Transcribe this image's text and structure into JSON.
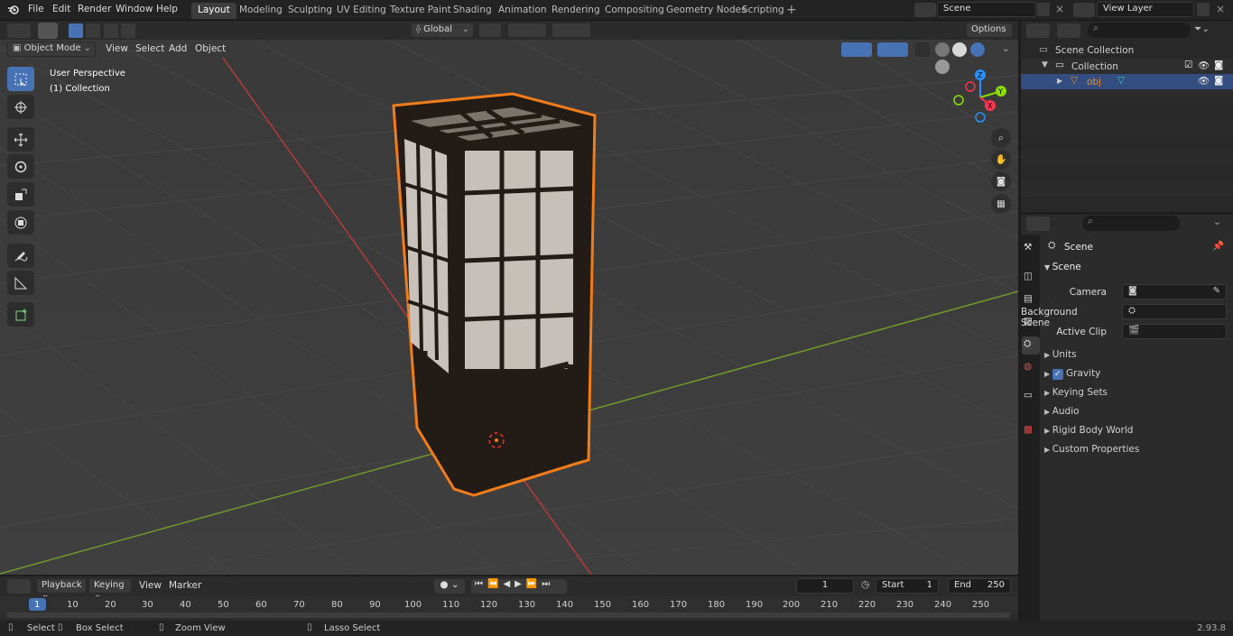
{
  "top_menu": [
    "File",
    "Edit",
    "Render",
    "Window",
    "Help"
  ],
  "workspaces": [
    "Layout",
    "Modeling",
    "Sculpting",
    "UV Editing",
    "Texture Paint",
    "Shading",
    "Animation",
    "Rendering",
    "Compositing",
    "Geometry Nodes",
    "Scripting"
  ],
  "scene_field": "Scene",
  "view_layer_field": "View Layer",
  "transform_orientation": "Global",
  "options_label": "Options",
  "mode_select": "Object Mode",
  "viewport_menu": [
    "View",
    "Select",
    "Add",
    "Object"
  ],
  "viewport_overlay": {
    "line1": "User Perspective",
    "line2": "(1) Collection"
  },
  "gizmo_axes": {
    "x": "X",
    "y": "Y",
    "z": "Z"
  },
  "outliner": {
    "scene_collection": "Scene Collection",
    "collection": "Collection",
    "object": "obj"
  },
  "properties": {
    "breadcrumb": "Scene",
    "panel_title": "Scene",
    "fields": [
      {
        "label": "Camera"
      },
      {
        "label": "Background Scene"
      },
      {
        "label": "Active Clip"
      }
    ],
    "sections": [
      "Units",
      "Gravity",
      "Keying Sets",
      "Audio",
      "Rigid Body World",
      "Custom Properties"
    ]
  },
  "timeline": {
    "menus": [
      "Playback",
      "Keying",
      "View",
      "Marker"
    ],
    "current_frame": "1",
    "start_label": "Start",
    "start_value": "1",
    "end_label": "End",
    "end_value": "250",
    "frame_markers": [
      "1",
      "10",
      "20",
      "30",
      "40",
      "50",
      "60",
      "70",
      "80",
      "90",
      "100",
      "110",
      "120",
      "130",
      "140",
      "150",
      "160",
      "170",
      "180",
      "190",
      "200",
      "210",
      "220",
      "230",
      "240",
      "250"
    ]
  },
  "statusbar": {
    "select": "Select",
    "box_select": "Box Select",
    "zoom_view": "Zoom View",
    "lasso_select": "Lasso Select",
    "version": "2.93.8"
  },
  "colors": {
    "accent": "#4772b3",
    "selection_outline": "#f07c1a",
    "x_axis": "#ff3352",
    "y_axis": "#8bdc00",
    "z_axis": "#2890ff"
  }
}
